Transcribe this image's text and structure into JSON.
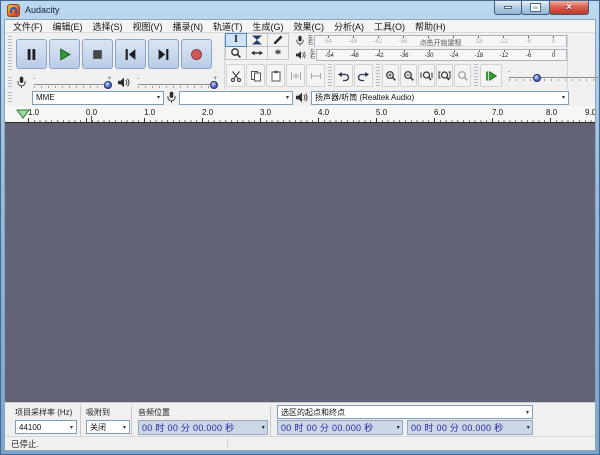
{
  "window": {
    "title": "Audacity"
  },
  "glyphs": {
    "close": "×",
    "dropdown": "▾",
    "slider_minus": "-",
    "slider_plus": "+",
    "ibeam": "I",
    "asterisk": "*"
  },
  "menu": {
    "items": [
      "文件(F)",
      "编辑(E)",
      "选择(S)",
      "视图(V)",
      "播录(N)",
      "轨道(T)",
      "生成(G)",
      "效果(C)",
      "分析(A)",
      "工具(O)",
      "帮助(H)"
    ]
  },
  "transport": {
    "buttons": [
      "pause",
      "play",
      "stop",
      "skip-to-start",
      "skip-to-end",
      "record"
    ]
  },
  "mixer": {
    "recording_volume_pct": 97,
    "playback_volume_pct": 97
  },
  "tools": {
    "buttons": [
      "selection",
      "envelope",
      "draw",
      "zoom",
      "time-shift",
      "multi"
    ],
    "selected": "selection"
  },
  "meters": {
    "record": {
      "channels": [
        "左",
        "右"
      ],
      "overlay": "点击开始监视",
      "scale": [
        "-54",
        "-48",
        "-42",
        "-36",
        "-30",
        "-24",
        "-18",
        "-12",
        "-6",
        "0"
      ]
    },
    "play": {
      "channels": [
        "左",
        "右"
      ],
      "scale": [
        "-54",
        "-48",
        "-42",
        "-36",
        "-30",
        "-24",
        "-18",
        "-12",
        "-6",
        "0"
      ]
    }
  },
  "edit": {
    "buttons": [
      "cut",
      "copy",
      "paste",
      "trim-outside-selection",
      "silence-selection",
      "undo",
      "redo",
      "zoom-in",
      "zoom-out",
      "fit-selection",
      "fit-project",
      "zoom-toggle"
    ]
  },
  "play_at_speed": {
    "slider_fraction": 0.3
  },
  "device": {
    "host": "MME",
    "recording_device": "",
    "playback_device": "扬声器/听筒 (Realtek Audio)"
  },
  "timeline": {
    "labels": [
      "1.0",
      "0.0",
      "1.0",
      "2.0",
      "3.0",
      "4.0",
      "5.0",
      "6.0",
      "7.0",
      "8.0",
      "9.0"
    ]
  },
  "selection_bar": {
    "rate_label": "项目采样率 (Hz)",
    "rate_value": "44100",
    "snap_label": "吸附到",
    "snap_value": "关闭",
    "position_label": "音频位置",
    "position_value": "00 时 00 分 00.000 秒",
    "range_label": "选区的起点和终点",
    "selection_start": "00 时 00 分 00.000 秒",
    "selection_end": "00 时 00 分 00.000 秒"
  },
  "status_bar": {
    "text": "已停止."
  }
}
